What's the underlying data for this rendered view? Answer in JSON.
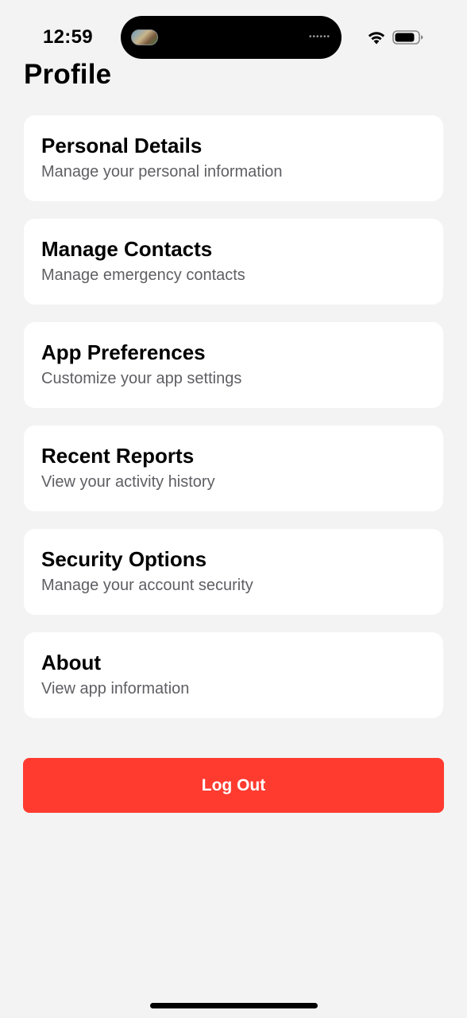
{
  "status_bar": {
    "time": "12:59",
    "island_indicator": "••••••"
  },
  "page": {
    "title": "Profile"
  },
  "menu": {
    "items": [
      {
        "title": "Personal Details",
        "subtitle": "Manage your personal information"
      },
      {
        "title": "Manage Contacts",
        "subtitle": "Manage emergency contacts"
      },
      {
        "title": "App Preferences",
        "subtitle": "Customize your app settings"
      },
      {
        "title": "Recent Reports",
        "subtitle": "View your activity history"
      },
      {
        "title": "Security Options",
        "subtitle": "Manage your account security"
      },
      {
        "title": "About",
        "subtitle": "View app information"
      }
    ]
  },
  "actions": {
    "logout_label": "Log Out"
  },
  "colors": {
    "background": "#f3f3f3",
    "card": "#ffffff",
    "logout": "#ff3b30",
    "subtitle": "#5f5f64"
  }
}
